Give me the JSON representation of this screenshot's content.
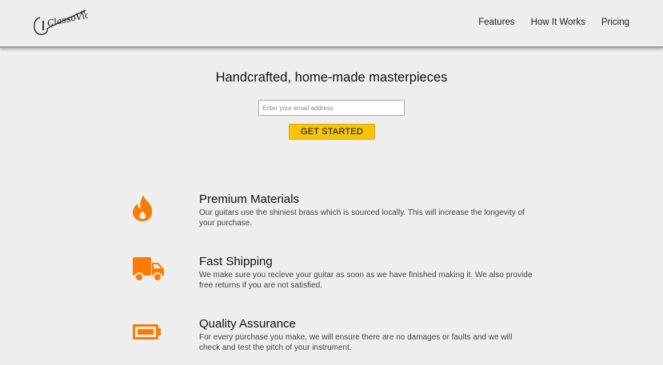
{
  "header": {
    "logo_text": "ClassoVio",
    "nav": [
      {
        "label": "Features"
      },
      {
        "label": "How It Works"
      },
      {
        "label": "Pricing"
      }
    ]
  },
  "hero": {
    "title": "Handcrafted, home-made masterpieces",
    "email_placeholder": "Enter your email address",
    "cta_label": "GET STARTED"
  },
  "features": [
    {
      "icon": "fire-icon",
      "title": "Premium Materials",
      "description": "Our guitars use the shiniest brass which is sourced locally. This will increase the longevity of your purchase."
    },
    {
      "icon": "truck-icon",
      "title": "Fast Shipping",
      "description": "We make sure you recieve your guitar as soon as we have finished making it. We also provide free returns if you are not satisfied."
    },
    {
      "icon": "battery-icon",
      "title": "Quality Assurance",
      "description": "For every purchase you make, we will ensure there are no damages or faults and we will check and test the pitch of your instrument."
    }
  ],
  "colors": {
    "accent": "#f5c20c",
    "icon": "#ff7a00",
    "background": "#eeeeee"
  }
}
